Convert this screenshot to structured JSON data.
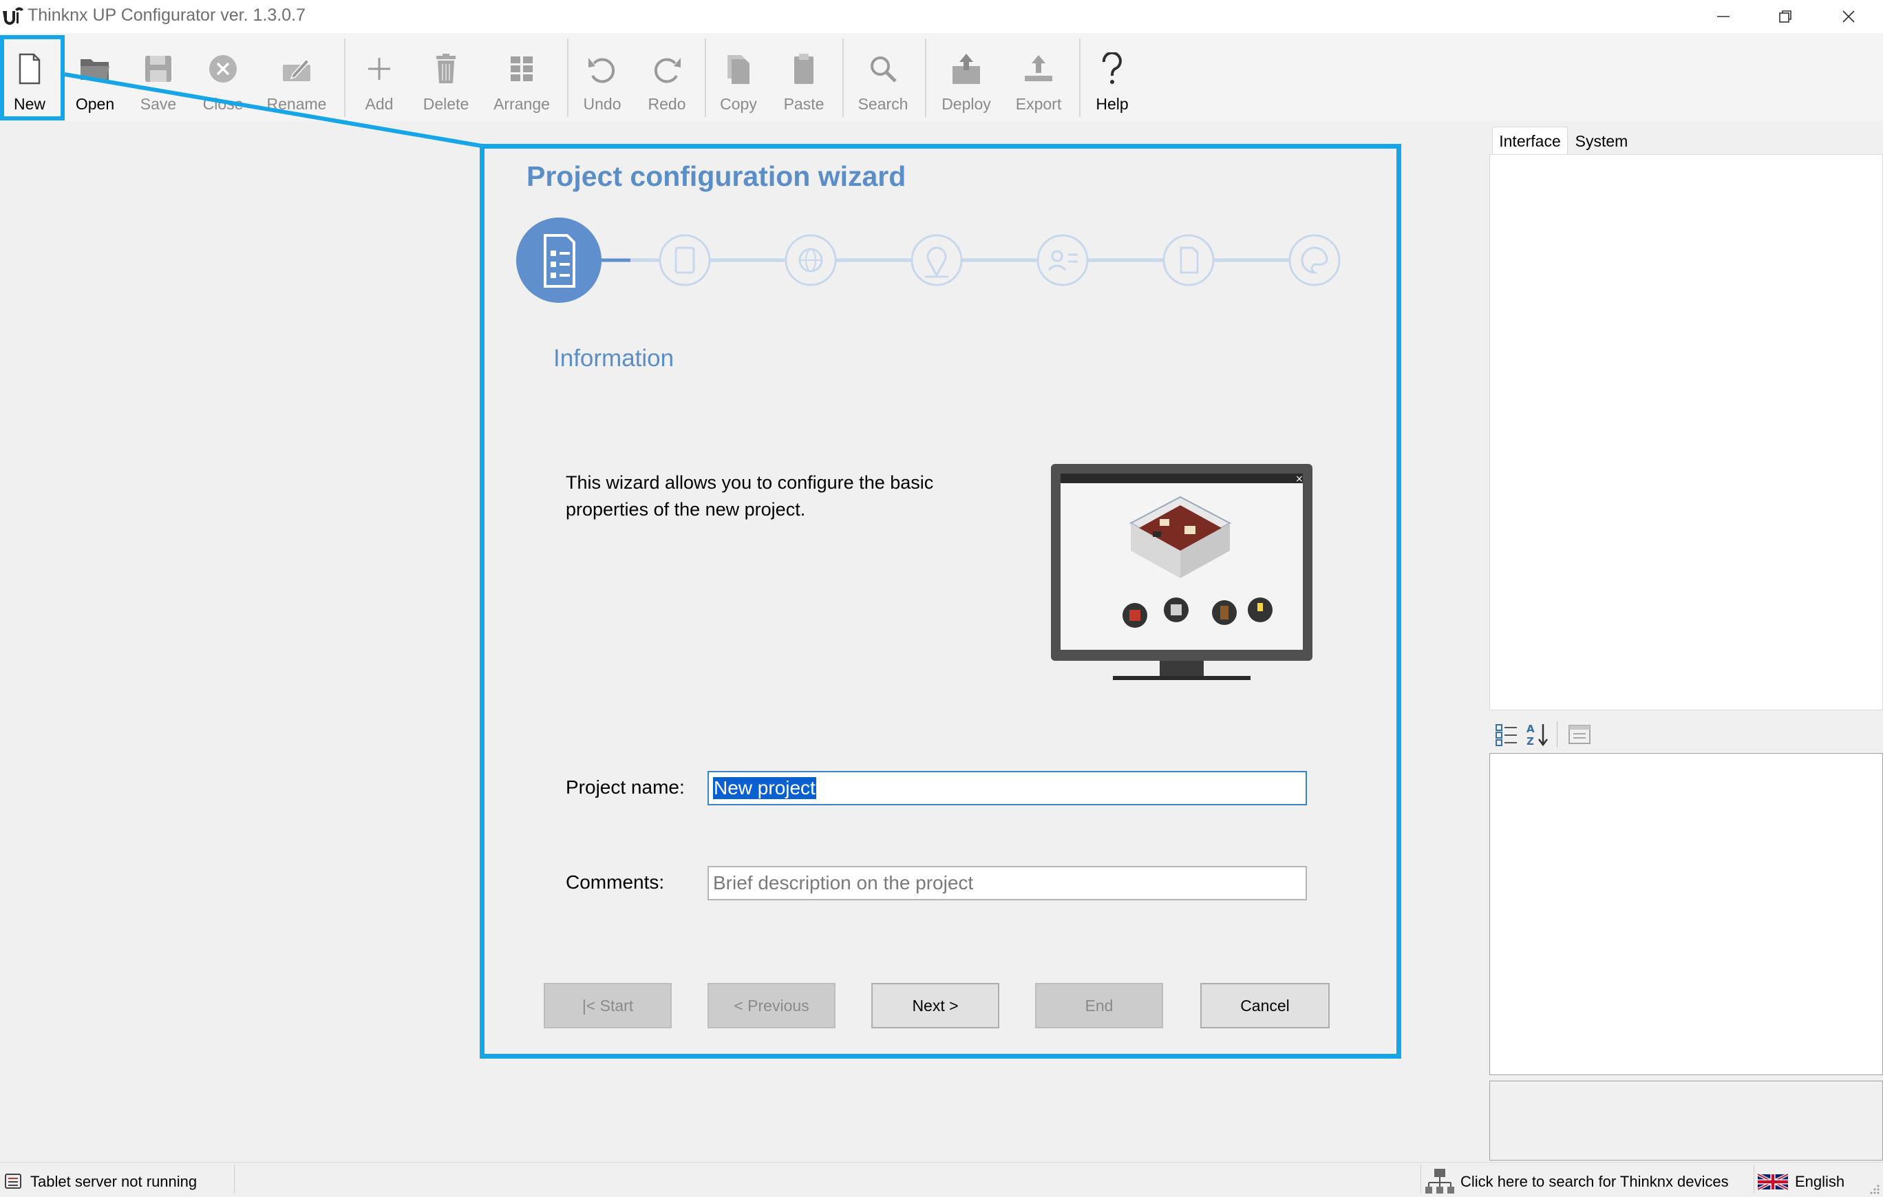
{
  "window": {
    "title": "Thinknx UP Configurator ver. 1.3.0.7"
  },
  "toolbar": {
    "new": "New",
    "open": "Open",
    "save": "Save",
    "close": "Close",
    "rename": "Rename",
    "add": "Add",
    "delete": "Delete",
    "arrange": "Arrange",
    "undo": "Undo",
    "redo": "Redo",
    "copy": "Copy",
    "paste": "Paste",
    "search": "Search",
    "deploy": "Deploy",
    "export": "Export",
    "help": "Help"
  },
  "wizard": {
    "title": "Project configuration wizard",
    "step_title": "Information",
    "intro": "This wizard allows you to configure the basic properties of the new project.",
    "current_step": 1,
    "total_steps": 7,
    "project_name_label": "Project name:",
    "project_name_value": "New project",
    "comments_label": "Comments:",
    "comments_placeholder": "Brief description on the project",
    "buttons": {
      "start": "|< Start",
      "previous": "< Previous",
      "next": "Next >",
      "end": "End",
      "cancel": "Cancel"
    }
  },
  "right_panel": {
    "tabs": [
      "Interface",
      "System"
    ],
    "active_tab": "Interface"
  },
  "statusbar": {
    "server_status": "Tablet server not running",
    "search_devices": "Click here to search for Thinknx devices",
    "language": "English"
  },
  "colors": {
    "accent": "#16a6e8",
    "wizard_blue": "#5b8ec6",
    "step_active": "#5f8fcc",
    "step_inactive": "#c8d8ec",
    "selection": "#0a5fd1"
  }
}
